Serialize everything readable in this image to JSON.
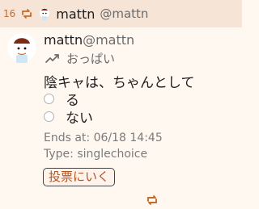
{
  "header": {
    "count": "16",
    "name": "mattn",
    "handle": "@mattn"
  },
  "post": {
    "name": "mattn",
    "handle": "@mattn",
    "location": "おっぱい"
  },
  "poll": {
    "question": "陰キャは、ちゃんとして",
    "options": [
      "る",
      "ない"
    ],
    "ends_at": "Ends at: 06/18 14:45",
    "type": "Type: singlechoice",
    "vote_button": "投票にいく"
  },
  "colors": {
    "accent": "#c96a2b",
    "header_bg": "#f6e4d6",
    "page_bg": "#fff8f0",
    "muted": "#7b7b7b"
  },
  "icons": [
    "retweet-icon",
    "mini-avatar",
    "avatar",
    "trend-icon",
    "retweet-icon"
  ]
}
